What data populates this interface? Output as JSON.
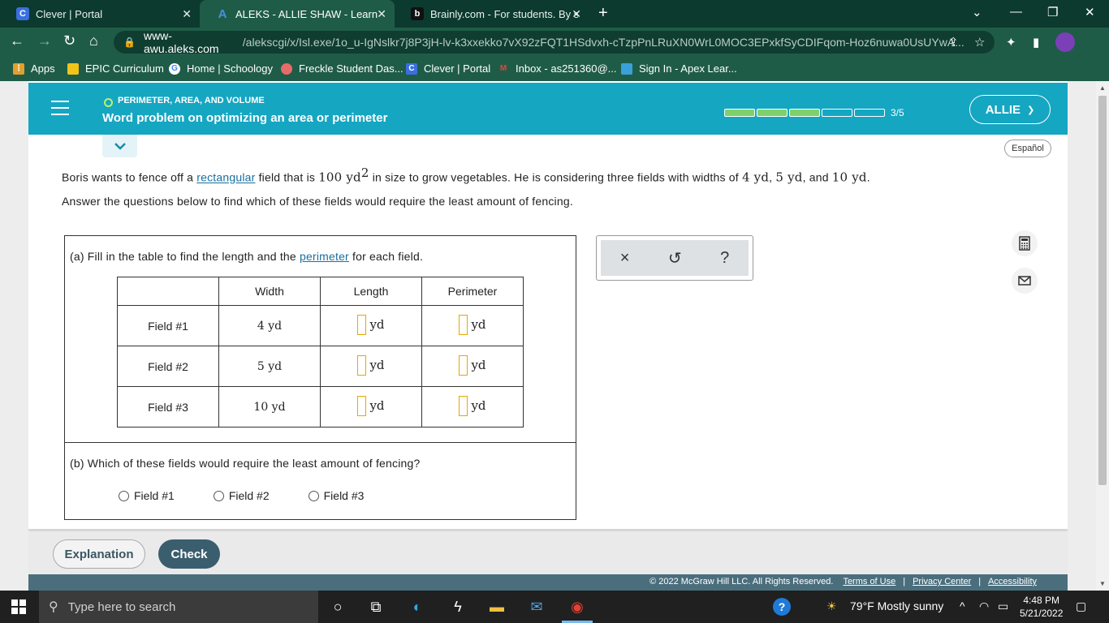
{
  "browser": {
    "tabs": [
      {
        "title": "Clever | Portal",
        "icon": "C",
        "active": false
      },
      {
        "title": "ALEKS - ALLIE SHAW - Learn",
        "icon": "A",
        "active": true
      },
      {
        "title": "Brainly.com - For students. By stu",
        "icon": "b",
        "active": false
      }
    ],
    "url_host": "www-awu.aleks.com",
    "url_path": "/alekscgi/x/Isl.exe/1o_u-IgNslkr7j8P3jH-lv-k3xxekko7vX92zFQT1HSdvxh-cTzpPnLRuXN0WrL0MOC3EPxkfSyCDIFqom-Hoz6nuwa0UsUYwA...",
    "bookmarks": [
      {
        "label": "Apps"
      },
      {
        "label": "EPIC Curriculum"
      },
      {
        "label": "Home | Schoology"
      },
      {
        "label": "Freckle Student Das..."
      },
      {
        "label": "Clever | Portal"
      },
      {
        "label": "Inbox - as251360@..."
      },
      {
        "label": "Sign In - Apex Lear..."
      }
    ]
  },
  "header": {
    "topic": "PERIMETER, AREA, AND VOLUME",
    "title": "Word problem on optimizing an area or perimeter",
    "progress_done": 3,
    "progress_total": 5,
    "progress_text": "3/5",
    "user": "ALLIE"
  },
  "espanol": "Español",
  "problem": {
    "p1_a": "Boris wants to fence off a ",
    "p1_link": "rectangular",
    "p1_b": " field that is ",
    "area": "100 yd",
    "area_exp": "2",
    "p1_c": " in size to grow vegetables. He is considering three fields with widths of ",
    "w1": "4 yd",
    "sep1": ", ",
    "w2": "5 yd",
    "sep2": ", and ",
    "w3": "10 yd",
    "p1_end": ".",
    "p2": "Answer the questions below to find which of these fields would require the least amount of fencing."
  },
  "part_a": {
    "label_a": "(a)  Fill in the table to find the length and the ",
    "label_link": "perimeter",
    "label_b": " for each field.",
    "headers": [
      "",
      "Width",
      "Length",
      "Perimeter"
    ],
    "unit": "yd",
    "rows": [
      {
        "name": "Field #1",
        "width": "4 yd",
        "length": "",
        "perimeter": ""
      },
      {
        "name": "Field #2",
        "width": "5 yd",
        "length": "",
        "perimeter": ""
      },
      {
        "name": "Field #3",
        "width": "10 yd",
        "length": "",
        "perimeter": ""
      }
    ]
  },
  "part_b": {
    "label": "(b)  Which of these fields would require the least amount of fencing?",
    "options": [
      "Field #1",
      "Field #2",
      "Field #3"
    ]
  },
  "tools": {
    "clear": "×",
    "undo": "↺",
    "help": "?"
  },
  "buttons": {
    "explanation": "Explanation",
    "check": "Check"
  },
  "footer": {
    "copyright": "© 2022 McGraw Hill LLC. All Rights Reserved.",
    "terms": "Terms of Use",
    "privacy": "Privacy Center",
    "accessibility": "Accessibility",
    "sep": "|"
  },
  "taskbar": {
    "search_placeholder": "Type here to search",
    "weather": "79°F  Mostly sunny",
    "time": "4:48 PM",
    "date": "5/21/2022"
  }
}
